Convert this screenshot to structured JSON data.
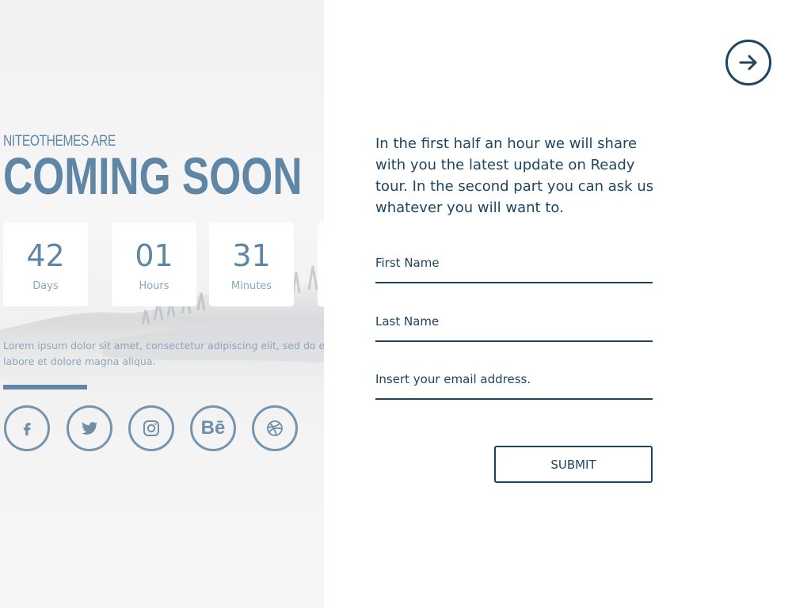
{
  "header": {
    "pre_title": "NITEOTHEMES ARE",
    "title": "COMING SOON"
  },
  "countdown": [
    {
      "value": "42",
      "label": "Days"
    },
    {
      "value": "01",
      "label": "Hours"
    },
    {
      "value": "31",
      "label": "Minutes"
    }
  ],
  "description": {
    "line1": "Lorem ipsum dolor sit amet, consectetur adipiscing elit, sed do ei",
    "line2": "labore et dolore magna aliqua."
  },
  "social": [
    {
      "icon": "facebook-icon"
    },
    {
      "icon": "twitter-icon"
    },
    {
      "icon": "instagram-icon"
    },
    {
      "icon": "behance-icon",
      "text": "Bē"
    },
    {
      "icon": "dribbble-icon"
    }
  ],
  "form": {
    "intro": "In the first half an hour we will share with you the latest update on Ready tour. In the second part you can ask us whatever you will want to.",
    "first_name_placeholder": "First Name",
    "last_name_placeholder": "Last Name",
    "email_placeholder": "Insert your email address.",
    "submit_label": "SUBMIT"
  },
  "nav": {
    "next_icon": "arrow-right-icon"
  },
  "colors": {
    "accent_light": "#5f86a4",
    "accent_dark": "#1d4560",
    "panel_bg": "#f3f3f3"
  }
}
